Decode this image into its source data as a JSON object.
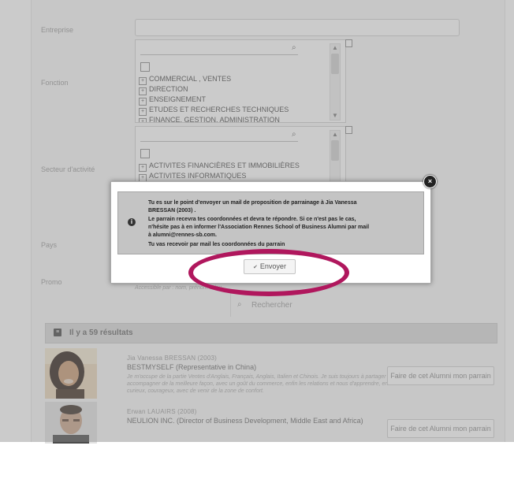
{
  "form": {
    "company_label": "Entreprise",
    "function_label": "Fonction",
    "sector_label": "Secteur d'activité",
    "country_label": "Pays",
    "promo_label": "Promo",
    "promo_hint": "Accessible par : nom, prénom et/ou ...",
    "search_button": "Rechercher",
    "function_tree": [
      "COMMERCIAL , VENTES",
      "DIRECTION",
      "ENSEIGNEMENT",
      "ETUDES ET RECHERCHES TECHNIQUES",
      "FINANCE, GESTION, ADMINISTRATION"
    ],
    "sector_tree": [
      "ACTIVITES FINANCIÈRES ET IMMOBILIÈRES",
      "ACTIVITES INFORMATIQUES"
    ]
  },
  "results": {
    "count_text": "Il y a 59 résultats",
    "items": [
      {
        "name": "Jia Vanessa BRESSAN (2003)",
        "company": "BESTMYSELF (Representative in China)",
        "desc": "Je m'occupe de la partie Ventes d'Anglais, Français, Anglais, Italien et Chinois. Je suis toujours à partager / accompagner de la meilleure façon, avec un goût du commerce, enfin les relations et nous d'apprendre, en curieux, courageux, avec de venir de la zone de confort.",
        "button": "Faire de cet Alumni mon parrain"
      },
      {
        "name": "Erwan LAUAIRS (2008)",
        "company": "NEULION INC. (Director of Business Development, Middle East and Africa)",
        "desc": "",
        "button": "Faire de cet Alumni mon parrain"
      }
    ]
  },
  "modal": {
    "line1": "Tu es sur le point d'envoyer un mail de proposition de parrainage à Jia Vanessa",
    "line2": "BRESSAN (2003) .",
    "line3": "Le parrain recevra tes coordonnées et devra te répondre. Si ce n'est pas le cas,",
    "line4": "n'hésite pas à en informer l'Association Rennes School of Business Alumni par mail",
    "line5": "à alumni@rennes-sb.com.",
    "line6": "Tu vas recevoir par mail les coordonnées du parrain",
    "send_label": "Envoyer",
    "close_symbol": "×"
  },
  "colors": {
    "highlight": "#b0175d",
    "overlay": "#8c8c8c"
  }
}
